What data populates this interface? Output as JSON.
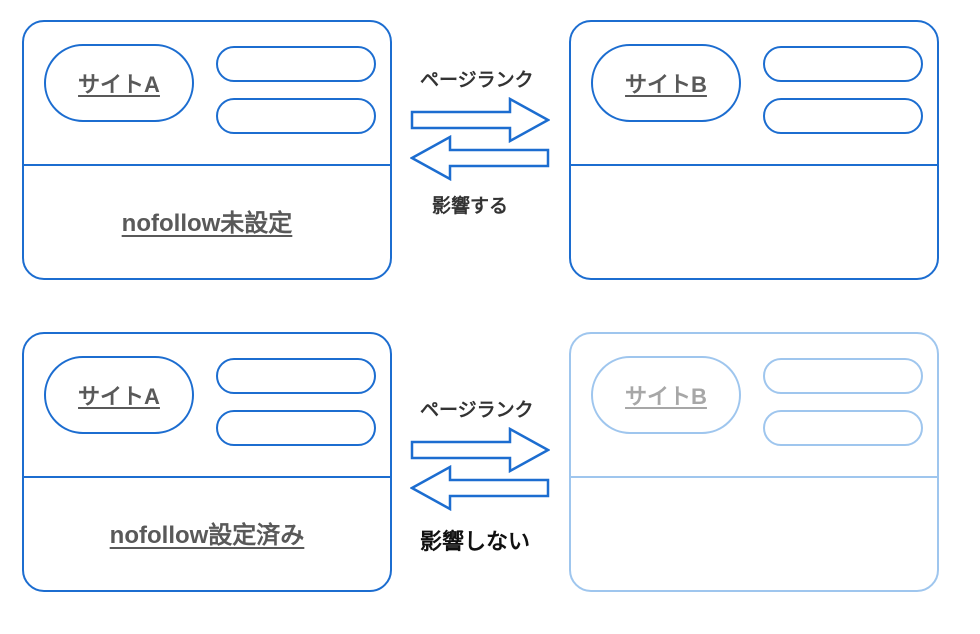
{
  "colors": {
    "primary": "#1C6DD0",
    "faded": "#9fc6ee",
    "text": "#595959"
  },
  "top": {
    "left_card": {
      "site_label": "サイトA",
      "caption": "nofollow未設定"
    },
    "right_card": {
      "site_label": "サイトB"
    },
    "labels": {
      "top": "ページランク",
      "bottom": "影響する"
    }
  },
  "bottom": {
    "left_card": {
      "site_label": "サイトA",
      "caption": "nofollow設定済み"
    },
    "right_card": {
      "site_label": "サイトB"
    },
    "labels": {
      "top": "ページランク",
      "bottom": "影響しない"
    }
  }
}
